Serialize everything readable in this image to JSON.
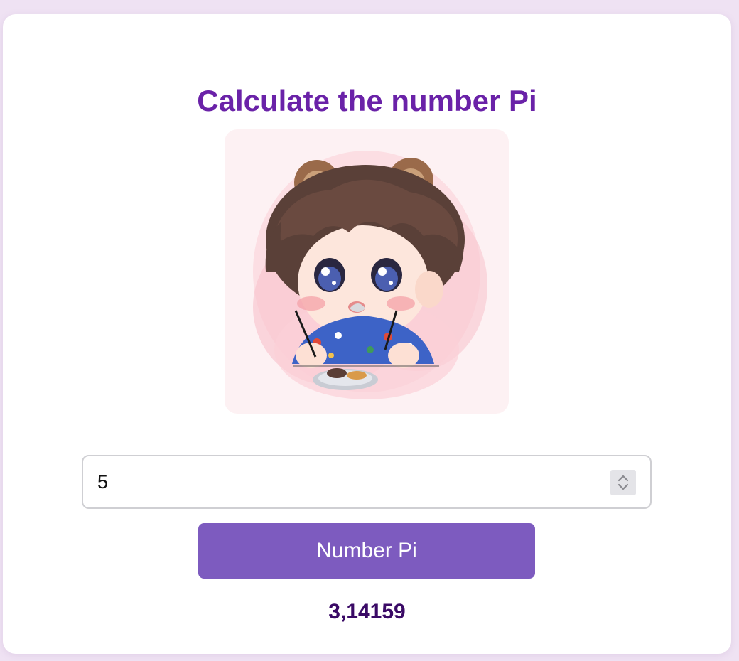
{
  "page": {
    "title": "Calculate the number Pi"
  },
  "illustration": {
    "icon": "chibi-character-eating-noodles-image"
  },
  "digits_input": {
    "value": "5"
  },
  "calculate_button": {
    "label": "Number Pi"
  },
  "result": {
    "value": "3,14159"
  },
  "colors": {
    "background": "#efe2f3",
    "card": "#ffffff",
    "title": "#6a22a8",
    "button": "#7d5bbf",
    "result": "#3a0a66",
    "illustration_bg": "#fdf1f3"
  }
}
